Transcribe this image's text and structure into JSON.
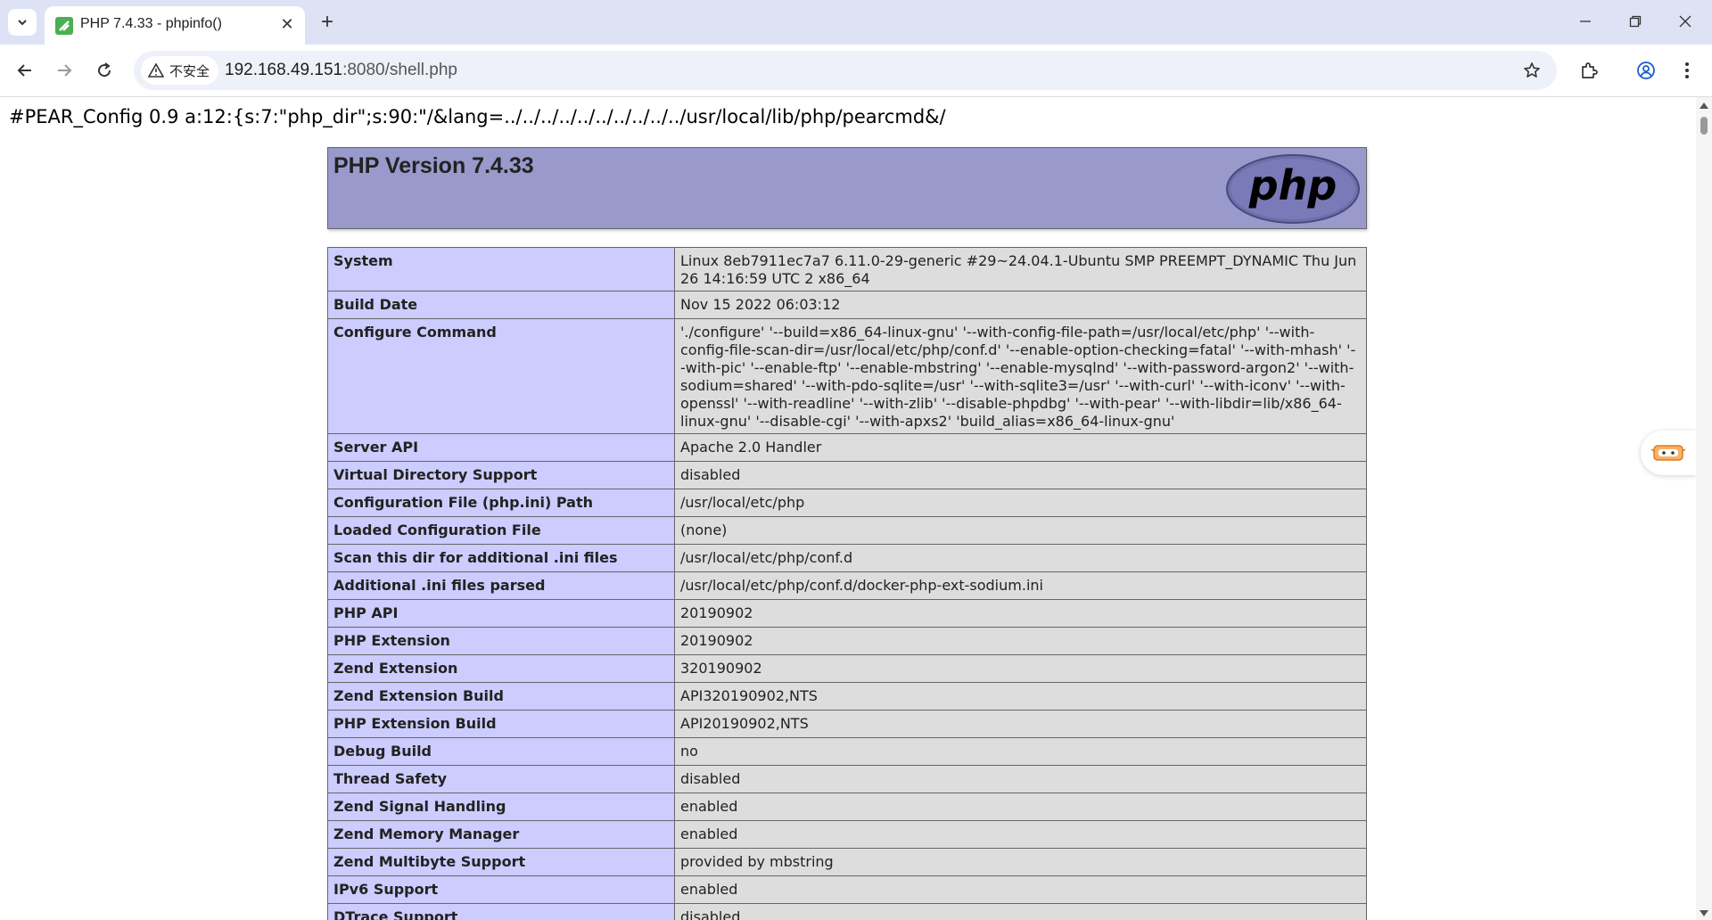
{
  "browser": {
    "tab_title": "PHP 7.4.33 - phpinfo()",
    "security_label": "不安全",
    "url_host": "192.168.49.151",
    "url_rest": ":8080/shell.php"
  },
  "page": {
    "pear_line": "#PEAR_Config 0.9 a:12:{s:7:\"php_dir\";s:90:\"/&lang=../../../../../../../../../../usr/local/lib/php/pearcmd&/",
    "php_version_title": "PHP Version 7.4.33",
    "logo_text": "php",
    "rows": [
      {
        "key": "System",
        "value": "Linux 8eb7911ec7a7 6.11.0-29-generic #29~24.04.1-Ubuntu SMP PREEMPT_DYNAMIC Thu Jun 26 14:16:59 UTC 2 x86_64"
      },
      {
        "key": "Build Date",
        "value": "Nov 15 2022 06:03:12"
      },
      {
        "key": "Configure Command",
        "value": "'./configure' '--build=x86_64-linux-gnu' '--with-config-file-path=/usr/local/etc/php' '--with-config-file-scan-dir=/usr/local/etc/php/conf.d' '--enable-option-checking=fatal' '--with-mhash' '--with-pic' '--enable-ftp' '--enable-mbstring' '--enable-mysqlnd' '--with-password-argon2' '--with-sodium=shared' '--with-pdo-sqlite=/usr' '--with-sqlite3=/usr' '--with-curl' '--with-iconv' '--with-openssl' '--with-readline' '--with-zlib' '--disable-phpdbg' '--with-pear' '--with-libdir=lib/x86_64-linux-gnu' '--disable-cgi' '--with-apxs2' 'build_alias=x86_64-linux-gnu'"
      },
      {
        "key": "Server API",
        "value": "Apache 2.0 Handler"
      },
      {
        "key": "Virtual Directory Support",
        "value": "disabled"
      },
      {
        "key": "Configuration File (php.ini) Path",
        "value": "/usr/local/etc/php"
      },
      {
        "key": "Loaded Configuration File",
        "value": "(none)"
      },
      {
        "key": "Scan this dir for additional .ini files",
        "value": "/usr/local/etc/php/conf.d"
      },
      {
        "key": "Additional .ini files parsed",
        "value": "/usr/local/etc/php/conf.d/docker-php-ext-sodium.ini"
      },
      {
        "key": "PHP API",
        "value": "20190902"
      },
      {
        "key": "PHP Extension",
        "value": "20190902"
      },
      {
        "key": "Zend Extension",
        "value": "320190902"
      },
      {
        "key": "Zend Extension Build",
        "value": "API320190902,NTS"
      },
      {
        "key": "PHP Extension Build",
        "value": "API20190902,NTS"
      },
      {
        "key": "Debug Build",
        "value": "no"
      },
      {
        "key": "Thread Safety",
        "value": "disabled"
      },
      {
        "key": "Zend Signal Handling",
        "value": "enabled"
      },
      {
        "key": "Zend Memory Manager",
        "value": "enabled"
      },
      {
        "key": "Zend Multibyte Support",
        "value": "provided by mbstring"
      },
      {
        "key": "IPv6 Support",
        "value": "enabled"
      },
      {
        "key": "DTrace Support",
        "value": "disabled"
      }
    ]
  },
  "colors": {
    "header_bg": "#9999cc",
    "key_cell_bg": "#ccccff",
    "value_cell_bg": "#dddddd",
    "titlebar_bg": "#dde3f5"
  }
}
